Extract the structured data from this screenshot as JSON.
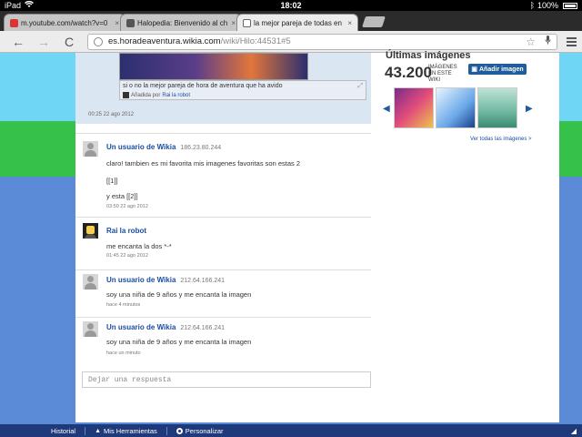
{
  "status_bar": {
    "device": "iPad",
    "wifi_icon": "wifi-icon",
    "time": "18:02",
    "bluetooth_icon": "bluetooth-icon",
    "battery": "100%"
  },
  "tabs": [
    {
      "title": "m.youtube.com/watch?v=0",
      "close": "×"
    },
    {
      "title": "Halopedia: Bienvenido al ch",
      "close": "×"
    },
    {
      "title": "la mejor pareja de todas en",
      "close": "×"
    }
  ],
  "toolbar": {
    "back": "←",
    "forward": "→",
    "reload": "C",
    "url_host": "es.horadeaventura.wikia.com",
    "url_path": "/wiki/Hilo:44531#5",
    "star": "☆",
    "mic": "🎤"
  },
  "prev_comment": {
    "caption": "si o no la mejor pareja de hora de aventura que ha avido",
    "added_by_prefix": "Añadida por",
    "added_by_user": "Rai la robot",
    "time": "00:25 22 ago 2012"
  },
  "sidebar": {
    "title": "Últimas imágenes",
    "count": "43.200",
    "count_label": "IMÁGENES EN ESTE WIKI",
    "add_button": "Añadir imagen",
    "see_all": "Ver todas las imágenes >",
    "prev_arrow": "◀",
    "next_arrow": "▶"
  },
  "comments": [
    {
      "author": "Un usuario de Wikia",
      "ip": "186.23.80.244",
      "lines": [
        "claro! tambien es mi favorita mis imagenes favoritas son estas 2",
        "[[1]]",
        "y esta [[2]]"
      ],
      "time": "03:50 22 ago 2012"
    },
    {
      "author": "Rai la robot",
      "ip": "",
      "lines": [
        "me encanta la dos *-*"
      ],
      "time": "01:45 22 ago 2012"
    },
    {
      "author": "Un usuario de Wikia",
      "ip": "212.64.166.241",
      "lines": [
        "soy una niña de 9 años y me encanta la imagen"
      ],
      "time": "hace 4 minutos"
    },
    {
      "author": "Un usuario de Wikia",
      "ip": "212.64.166.241",
      "lines": [
        "soy una niña de 9 años y me encanta la imagen"
      ],
      "time": "hace un minuto"
    }
  ],
  "reply": {
    "placeholder": "Dejar una respuesta"
  },
  "bottom_bar": {
    "historial": "Historial",
    "herramientas": "Mis Herramientas",
    "personalizar": "Personalizar",
    "caret": "▲"
  }
}
